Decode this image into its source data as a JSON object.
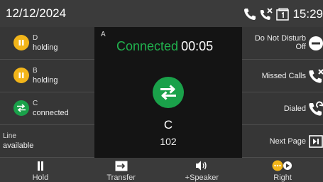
{
  "status_bar": {
    "date": "12/12/2024",
    "time": "15:29",
    "icons": [
      "phone-handset-icon",
      "missed-call-icon",
      "voicemail-icon"
    ]
  },
  "lines": [
    {
      "name": "D",
      "state": "holding",
      "icon": "pause-icon",
      "color": "#f2b51a"
    },
    {
      "name": "B",
      "state": "holding",
      "icon": "pause-icon",
      "color": "#f2b51a"
    },
    {
      "name": "C",
      "state": "connected",
      "icon": "transfer-arrows-icon",
      "color": "#1aa14a"
    },
    {
      "name": "Line",
      "state": "available"
    }
  ],
  "active_call": {
    "tag": "A",
    "status": "Connected",
    "duration": "00:05",
    "contact_name": "C",
    "contact_number": "102",
    "status_color": "#21b24e"
  },
  "softkeys": [
    {
      "label_line1": "Do Not Disturb",
      "label_line2": "Off",
      "icon": "minus-circle-icon"
    },
    {
      "label": "Missed Calls",
      "icon": "missed-call-icon"
    },
    {
      "label": "Dialed",
      "icon": "dialed-call-icon"
    },
    {
      "label": "Next Page",
      "icon": "next-page-icon"
    }
  ],
  "bottom_keys": [
    {
      "label": "Hold",
      "icon": "pause-icon"
    },
    {
      "label": "Transfer",
      "icon": "transfer-icon"
    },
    {
      "label": "+Speaker",
      "icon": "speaker-icon"
    },
    {
      "label": "Right",
      "icon": "more-options-icon"
    }
  ]
}
